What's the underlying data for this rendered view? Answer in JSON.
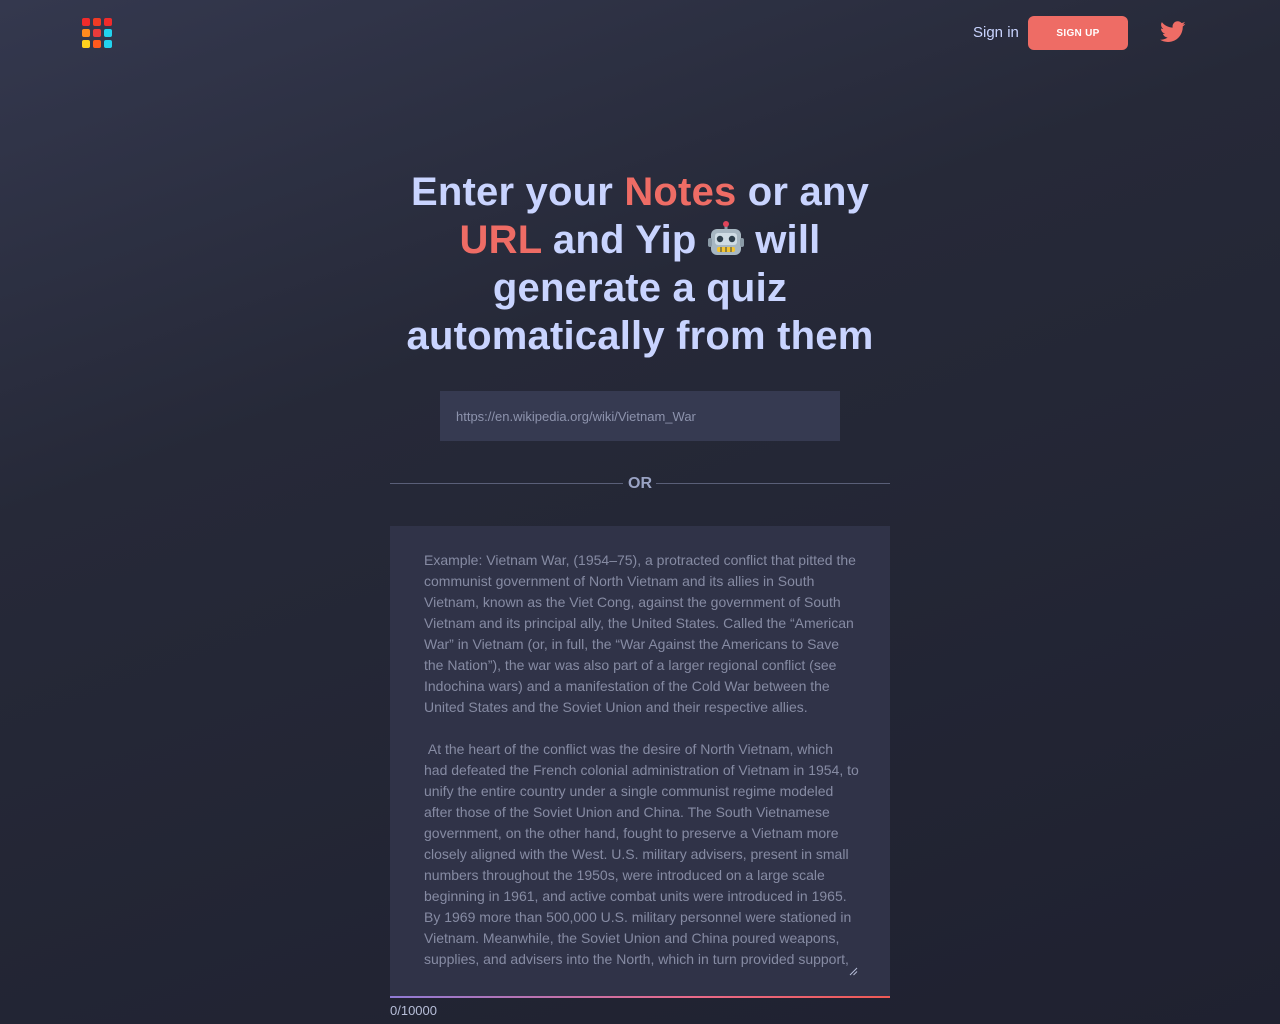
{
  "header": {
    "logo_colors": [
      "#f02b2b",
      "#f03b25",
      "#f02b2b",
      "#ff8a1e",
      "#e83b3b",
      "#22d3ee",
      "#ffd21e",
      "#ff5a1e",
      "#22d3ee"
    ],
    "signin_label": "Sign in",
    "signup_label": "SIGN UP",
    "social_icon": "twitter-icon"
  },
  "hero": {
    "part1": "Enter your ",
    "notes_word": "Notes",
    "part2": " or any ",
    "url_word": "URL",
    "part3": " and Yip ",
    "robot_icon": "robot-icon",
    "part4": " will generate a quiz automatically from them"
  },
  "url_input": {
    "placeholder": "https://en.wikipedia.org/wiki/Vietnam_War",
    "value": ""
  },
  "divider": {
    "label": "OR"
  },
  "notes_input": {
    "placeholder": "Example: Vietnam War, (1954–75), a protracted conflict that pitted the communist government of North Vietnam and its allies in South Vietnam, known as the Viet Cong, against the government of South Vietnam and its principal ally, the United States. Called the “American War” in Vietnam (or, in full, the “War Against the Americans to Save the Nation”), the war was also part of a larger regional conflict (see Indochina wars) and a manifestation of the Cold War between the United States and the Soviet Union and their respective allies.\n\n At the heart of the conflict was the desire of North Vietnam, which had defeated the French colonial administration of Vietnam in 1954, to unify the entire country under a single communist regime modeled after those of the Soviet Union and China. The South Vietnamese government, on the other hand, fought to preserve a Vietnam more closely aligned with the West. U.S. military advisers, present in small numbers throughout the 1950s, were introduced on a large scale beginning in 1961, and active combat units were introduced in 1965. By 1969 more than 500,000 U.S. military personnel were stationed in Vietnam. Meanwhile, the Soviet Union and China poured weapons, supplies, and advisers into the North, which in turn provided support,",
    "char_count": "0/10000"
  },
  "colors": {
    "background": "#262938",
    "accent": "#ee6c65",
    "heading": "#c9d4ff",
    "input_bg": "#363a51"
  }
}
